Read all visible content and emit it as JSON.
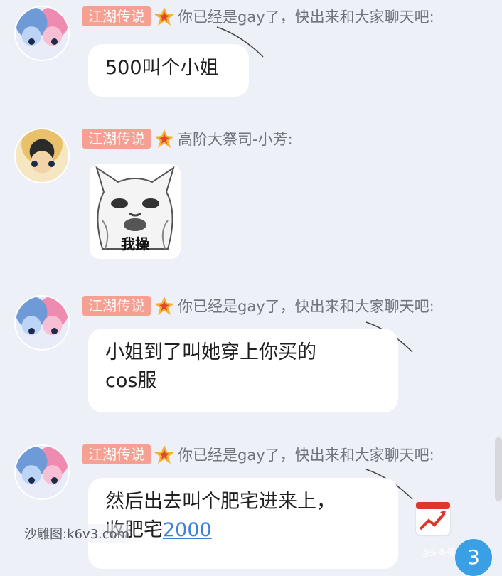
{
  "messages": [
    {
      "avatar": "twin-anime-girls-avatar",
      "badge": "江湖传说",
      "title": "你已经是gay了，快出来和大家聊天吧:",
      "text": "500叫个小姐"
    },
    {
      "avatar": "straw-hat-boy-avatar",
      "badge": "江湖传说",
      "title": "高阶大祭司-小芳:",
      "sticker_text": "我操"
    },
    {
      "avatar": "twin-anime-girls-avatar",
      "badge": "江湖传说",
      "title": "你已经是gay了，快出来和大家聊天吧:",
      "text_line1": "小姐到了叫她穿上你买的",
      "text_line2": "cos服"
    },
    {
      "avatar": "twin-anime-girls-avatar",
      "badge": "江湖传说",
      "title": "你已经是gay了，快出来和大家聊天吧:",
      "text_line1": "然后出去叫个肥宅进来上，",
      "text_line2_prefix": "收肥宅",
      "text_line2_link": "2000"
    }
  ],
  "watermark": "沙雕图:k6v3.com",
  "watermark_small": "@头条号",
  "unread_count": "3",
  "colors": {
    "background": "#eef0f8",
    "badge": "#f5a093",
    "title": "#6f737a",
    "link": "#3d7fd9",
    "counter": "#3aa0e6"
  },
  "icons": [
    "star-badge-icon",
    "trend-chart-icon"
  ]
}
